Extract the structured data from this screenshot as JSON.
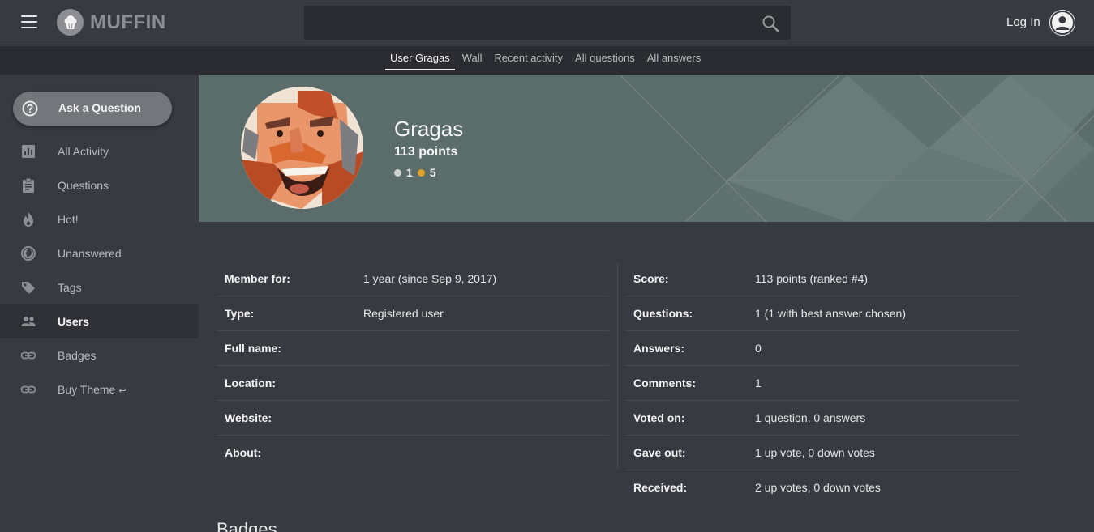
{
  "header": {
    "brand": "MUFFIN",
    "login_label": "Log In",
    "search": {
      "value": ""
    }
  },
  "subnav": {
    "tabs": [
      {
        "label": "User Gragas",
        "active": true
      },
      {
        "label": "Wall"
      },
      {
        "label": "Recent activity"
      },
      {
        "label": "All questions"
      },
      {
        "label": "All answers"
      }
    ]
  },
  "sidebar": {
    "ask_label": "Ask a Question",
    "items": [
      {
        "label": "All Activity",
        "icon": "bar-chart-icon"
      },
      {
        "label": "Questions",
        "icon": "clipboard-icon"
      },
      {
        "label": "Hot!",
        "icon": "flame-icon"
      },
      {
        "label": "Unanswered",
        "icon": "half-moon-icon"
      },
      {
        "label": "Tags",
        "icon": "tag-icon"
      },
      {
        "label": "Users",
        "icon": "users-icon",
        "active": true
      },
      {
        "label": "Badges",
        "icon": "link-icon"
      },
      {
        "label": "Buy Theme",
        "icon": "link-icon",
        "suffix": "↩"
      }
    ]
  },
  "profile": {
    "name": "Gragas",
    "points": "113 points",
    "medals": [
      {
        "count": "1",
        "color": "#d0d0d0"
      },
      {
        "count": "5",
        "color": "#e0a12a"
      }
    ]
  },
  "info_left": [
    {
      "label": "Member for:",
      "value": "1 year (since Sep 9, 2017)"
    },
    {
      "label": "Type:",
      "value": "Registered user"
    },
    {
      "label": "Full name:",
      "value": ""
    },
    {
      "label": "Location:",
      "value": ""
    },
    {
      "label": "Website:",
      "value": ""
    },
    {
      "label": "About:",
      "value": ""
    }
  ],
  "info_right": [
    {
      "label": "Score:",
      "value": "113 points (ranked #4)"
    },
    {
      "label": "Questions:",
      "value": "1 (1 with best answer chosen)"
    },
    {
      "label": "Answers:",
      "value": "0"
    },
    {
      "label": "Comments:",
      "value": "1"
    },
    {
      "label": "Voted on:",
      "value": "1 question, 0 answers"
    },
    {
      "label": "Gave out:",
      "value": "1 up vote, 0 down votes"
    },
    {
      "label": "Received:",
      "value": "2 up votes, 0 down votes"
    }
  ],
  "badges_heading": "Badges",
  "colors": {
    "background": "#383a42",
    "subnav": "#2a2c31",
    "banner": "#5a6d6b",
    "button": "#73767b"
  }
}
